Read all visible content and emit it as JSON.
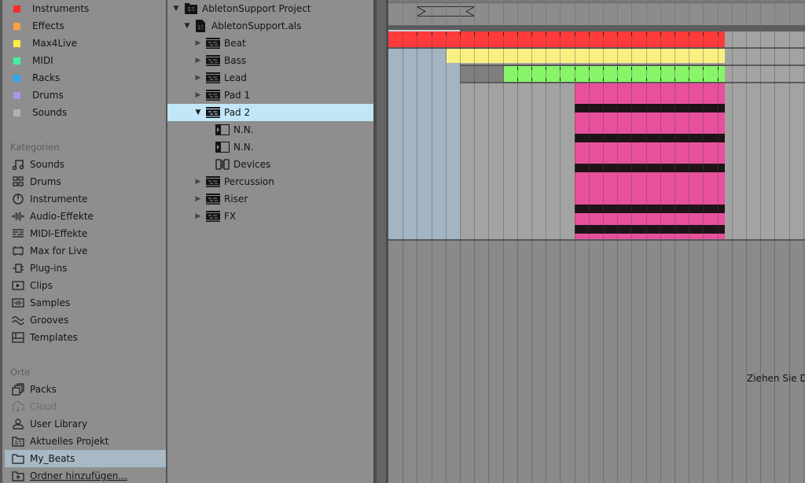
{
  "sidebar": {
    "collections": [
      {
        "label": "Instruments",
        "color": "#ff2a2a"
      },
      {
        "label": "Effects",
        "color": "#ffa040"
      },
      {
        "label": "Max4Live",
        "color": "#ffee44"
      },
      {
        "label": "MIDI",
        "color": "#3ef0a0"
      },
      {
        "label": "Racks",
        "color": "#2aa8f0"
      },
      {
        "label": "Drums",
        "color": "#b090f0"
      },
      {
        "label": "Sounds",
        "color": "#b0b0b0"
      }
    ],
    "categories_header": "Kategorien",
    "categories": [
      {
        "label": "Sounds",
        "icon": "music-note-icon"
      },
      {
        "label": "Drums",
        "icon": "drum-grid-icon"
      },
      {
        "label": "Instrumente",
        "icon": "knob-icon"
      },
      {
        "label": "Audio-Effekte",
        "icon": "waveform-icon"
      },
      {
        "label": "MIDI-Effekte",
        "icon": "midi-lines-icon"
      },
      {
        "label": "Max for Live",
        "icon": "max-device-icon"
      },
      {
        "label": "Plug-ins",
        "icon": "plug-icon"
      },
      {
        "label": "Clips",
        "icon": "clip-play-icon"
      },
      {
        "label": "Samples",
        "icon": "sample-wave-icon"
      },
      {
        "label": "Grooves",
        "icon": "groove-icon"
      },
      {
        "label": "Templates",
        "icon": "template-icon"
      }
    ],
    "places_header": "Orte",
    "places": [
      {
        "label": "Packs",
        "icon": "packs-icon"
      },
      {
        "label": "Cloud",
        "icon": "cloud-icon"
      },
      {
        "label": "User Library",
        "icon": "user-icon"
      },
      {
        "label": "Aktuelles Projekt",
        "icon": "project-folder-icon"
      },
      {
        "label": "My_Beats",
        "icon": "folder-icon"
      },
      {
        "label": "Ordner hinzufügen...",
        "icon": "add-folder-icon"
      }
    ]
  },
  "tree": {
    "items": [
      {
        "label": "AbletonSupport Project",
        "depth": 0,
        "expander": "open",
        "icon": "project-icon"
      },
      {
        "label": "AbletonSupport.als",
        "depth": 1,
        "expander": "open",
        "icon": "als-file-icon"
      },
      {
        "label": "Beat",
        "depth": 2,
        "expander": "closed",
        "icon": "track-icon"
      },
      {
        "label": "Bass",
        "depth": 2,
        "expander": "closed",
        "icon": "track-icon"
      },
      {
        "label": "Lead",
        "depth": 2,
        "expander": "closed",
        "icon": "track-icon"
      },
      {
        "label": "Pad 1",
        "depth": 2,
        "expander": "closed",
        "icon": "track-icon"
      },
      {
        "label": "Pad 2",
        "depth": 2,
        "expander": "open",
        "icon": "track-icon",
        "selected": true
      },
      {
        "label": "N.N.",
        "depth": 3,
        "expander": "none",
        "icon": "clip-icon"
      },
      {
        "label": "N.N.",
        "depth": 3,
        "expander": "none",
        "icon": "clip-icon"
      },
      {
        "label": "Devices",
        "depth": 3,
        "expander": "none",
        "icon": "devices-icon"
      },
      {
        "label": "Percussion",
        "depth": 2,
        "expander": "closed",
        "icon": "track-icon"
      },
      {
        "label": "Riser",
        "depth": 2,
        "expander": "closed",
        "icon": "track-icon"
      },
      {
        "label": "FX",
        "depth": 2,
        "expander": "closed",
        "icon": "track-icon"
      }
    ]
  },
  "arrangement": {
    "drop_hint": "Ziehen Sie Da",
    "colors": {
      "beat": "#ff3a3a",
      "bass": "#f8f080",
      "lead": "#88f468",
      "pad": "#e8509c",
      "pad_dark": "#1e1418",
      "selection": "#a3b4c2"
    }
  }
}
